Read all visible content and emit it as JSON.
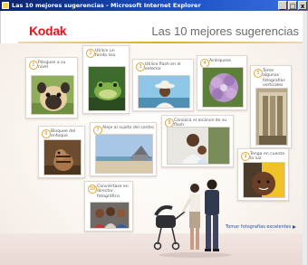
{
  "window": {
    "title": "Las 10 mejores sugerencias - Microsoft Internet Explorer",
    "minimize": "_",
    "maximize": "□",
    "close": "x"
  },
  "header": {
    "brand": "Kodak",
    "headline": "Las 10 mejores sugerencias"
  },
  "tips": [
    {
      "number": "1",
      "caption": "Pónguse a su nivel",
      "icon": "pug-dog-photo"
    },
    {
      "number": "2",
      "caption": "Utilice un fondo liso",
      "icon": "frog-photo"
    },
    {
      "number": "3",
      "caption": "Utilice flash en el exterior",
      "icon": "woman-in-hat-photo"
    },
    {
      "number": "4",
      "caption": "Acérquese",
      "icon": "purple-flower-photo"
    },
    {
      "number": "5",
      "caption": "Tome algunas fotografías verticales",
      "icon": "building-interior-photo"
    },
    {
      "number": "6",
      "caption": "Bloquee del enfoque",
      "icon": "chipmunk-photo"
    },
    {
      "number": "7",
      "caption": "Aleje al sujeto del centro",
      "icon": "beach-house-photo"
    },
    {
      "number": "8",
      "caption": "Conozca el alcance de su flash",
      "icon": "mother-and-child-photo"
    },
    {
      "number": "9",
      "caption": "Tenga en cuenta la luz",
      "icon": "child-portrait-photo"
    },
    {
      "number": "10",
      "caption": "Conviértase en director fotográfico",
      "icon": "group-portrait-photo"
    }
  ],
  "footer": {
    "link": "Tomar fotografías excelentes"
  },
  "colors": {
    "brand": "#e4141c",
    "accent": "#e3a62f",
    "link": "#2b4fa8",
    "titlebar": "#0a246a"
  }
}
